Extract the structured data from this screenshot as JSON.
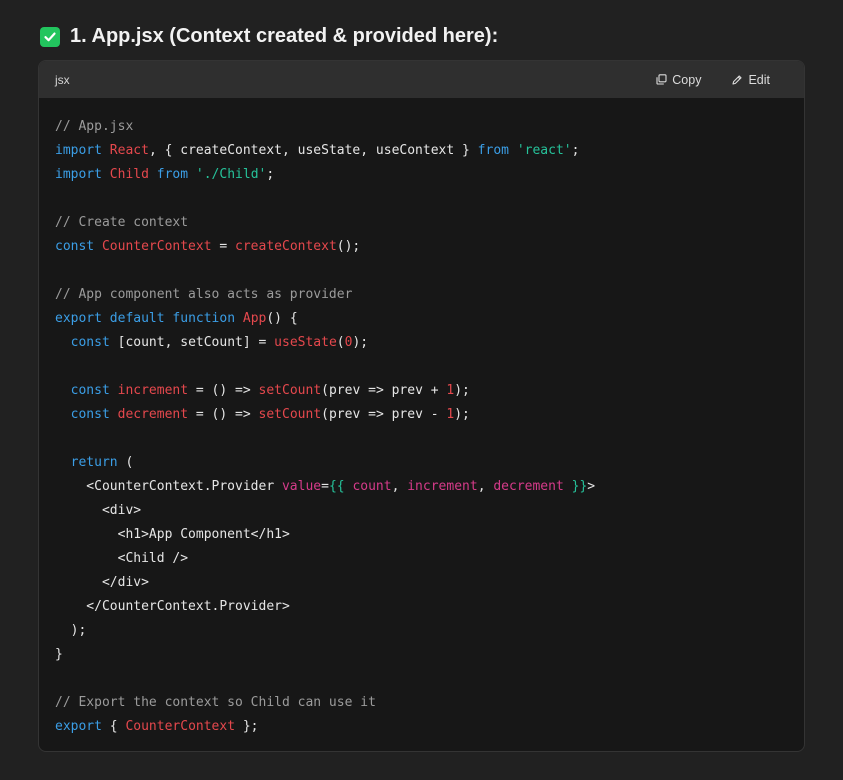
{
  "heading": {
    "title": "1. App.jsx (Context created & provided here):"
  },
  "code_block": {
    "language": "jsx",
    "copy_label": "Copy",
    "edit_label": "Edit",
    "lines": [
      [
        [
          "cmt",
          "// App.jsx"
        ]
      ],
      [
        [
          "kw",
          "import"
        ],
        [
          "pl",
          " "
        ],
        [
          "id",
          "React"
        ],
        [
          "pl",
          ", { createContext, useState, useContext } "
        ],
        [
          "kw",
          "from"
        ],
        [
          "pl",
          " "
        ],
        [
          "str",
          "'react'"
        ],
        [
          "pl",
          ";"
        ]
      ],
      [
        [
          "kw",
          "import"
        ],
        [
          "pl",
          " "
        ],
        [
          "id",
          "Child"
        ],
        [
          "pl",
          " "
        ],
        [
          "kw",
          "from"
        ],
        [
          "pl",
          " "
        ],
        [
          "str",
          "'./Child'"
        ],
        [
          "pl",
          ";"
        ]
      ],
      [],
      [
        [
          "cmt",
          "// Create context"
        ]
      ],
      [
        [
          "kw",
          "const"
        ],
        [
          "pl",
          " "
        ],
        [
          "id",
          "CounterContext"
        ],
        [
          "pl",
          " = "
        ],
        [
          "fn",
          "createContext"
        ],
        [
          "pl",
          "();"
        ]
      ],
      [],
      [
        [
          "cmt",
          "// App component also acts as provider"
        ]
      ],
      [
        [
          "kw",
          "export"
        ],
        [
          "pl",
          " "
        ],
        [
          "kw",
          "default"
        ],
        [
          "pl",
          " "
        ],
        [
          "kw",
          "function"
        ],
        [
          "pl",
          " "
        ],
        [
          "fn",
          "App"
        ],
        [
          "pl",
          "() {"
        ]
      ],
      [
        [
          "pl",
          "  "
        ],
        [
          "kw",
          "const"
        ],
        [
          "pl",
          " [count, setCount] = "
        ],
        [
          "fn",
          "useState"
        ],
        [
          "pl",
          "("
        ],
        [
          "num",
          "0"
        ],
        [
          "pl",
          ");"
        ]
      ],
      [],
      [
        [
          "pl",
          "  "
        ],
        [
          "kw",
          "const"
        ],
        [
          "pl",
          " "
        ],
        [
          "id",
          "increment"
        ],
        [
          "pl",
          " = () => "
        ],
        [
          "fn",
          "setCount"
        ],
        [
          "pl",
          "(prev => prev + "
        ],
        [
          "num",
          "1"
        ],
        [
          "pl",
          ");"
        ]
      ],
      [
        [
          "pl",
          "  "
        ],
        [
          "kw",
          "const"
        ],
        [
          "pl",
          " "
        ],
        [
          "id",
          "decrement"
        ],
        [
          "pl",
          " = () => "
        ],
        [
          "fn",
          "setCount"
        ],
        [
          "pl",
          "(prev => prev - "
        ],
        [
          "num",
          "1"
        ],
        [
          "pl",
          ");"
        ]
      ],
      [],
      [
        [
          "pl",
          "  "
        ],
        [
          "kw",
          "return"
        ],
        [
          "pl",
          " ("
        ]
      ],
      [
        [
          "pl",
          "    <CounterContext.Provider "
        ],
        [
          "attr",
          "value"
        ],
        [
          "pl",
          "="
        ],
        [
          "str",
          "{{"
        ],
        [
          "pl",
          " "
        ],
        [
          "attr",
          "count"
        ],
        [
          "pl",
          ", "
        ],
        [
          "attr",
          "increment"
        ],
        [
          "pl",
          ", "
        ],
        [
          "attr",
          "decrement"
        ],
        [
          "pl",
          " "
        ],
        [
          "str",
          "}}"
        ],
        [
          "pl",
          ">"
        ]
      ],
      [
        [
          "pl",
          "      <div>"
        ]
      ],
      [
        [
          "pl",
          "        <h1>App Component</h1>"
        ]
      ],
      [
        [
          "pl",
          "        <Child />"
        ]
      ],
      [
        [
          "pl",
          "      </div>"
        ]
      ],
      [
        [
          "pl",
          "    </CounterContext.Provider>"
        ]
      ],
      [
        [
          "pl",
          "  );"
        ]
      ],
      [
        [
          "pl",
          "}"
        ]
      ],
      [],
      [
        [
          "cmt",
          "// Export the context so Child can use it"
        ]
      ],
      [
        [
          "kw",
          "export"
        ],
        [
          "pl",
          " { "
        ],
        [
          "id",
          "CounterContext"
        ],
        [
          "pl",
          " };"
        ]
      ]
    ]
  },
  "colors": {
    "background": "#212121",
    "code_bg": "#171717",
    "header_bg": "#2f2f2f",
    "keyword": "#3b9ee6",
    "identifier": "#e5484d",
    "string": "#26c29a",
    "comment": "#9b9b9b",
    "check": "#22c55e"
  },
  "icons": [
    "check-icon",
    "copy-icon",
    "edit-icon"
  ]
}
